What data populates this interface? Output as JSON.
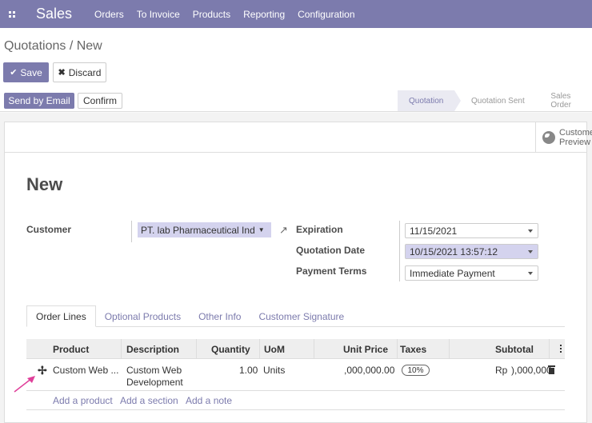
{
  "navbar": {
    "app_name": "Sales",
    "menu": [
      "Orders",
      "To Invoice",
      "Products",
      "Reporting",
      "Configuration"
    ]
  },
  "breadcrumb": "Quotations / New",
  "buttons": {
    "save": "Save",
    "discard": "Discard",
    "send_by_email": "Send by Email",
    "confirm": "Confirm"
  },
  "statusbar": {
    "stages": [
      "Quotation",
      "Quotation Sent",
      "Sales Order"
    ],
    "active": "Quotation"
  },
  "customer_preview": [
    "Customer",
    "Preview"
  ],
  "form": {
    "title": "New",
    "customer_label": "Customer",
    "customer_value": "PT.      lab Pharmaceutical Ind",
    "expiration_label": "Expiration",
    "expiration_value": "11/15/2021",
    "quotation_date_label": "Quotation Date",
    "quotation_date_value": "10/15/2021 13:57:12",
    "payment_terms_label": "Payment Terms",
    "payment_terms_value": "Immediate Payment"
  },
  "tabs": [
    "Order Lines",
    "Optional Products",
    "Other Info",
    "Customer Signature"
  ],
  "order_lines": {
    "headers": [
      "Product",
      "Description",
      "Quantity",
      "UoM",
      "Unit Price",
      "Taxes",
      "Subtotal"
    ],
    "rows": [
      {
        "product": "Custom Web ...",
        "description_1": "Custom Web",
        "description_2": "Development",
        "quantity": "1.00",
        "uom": "Units",
        "unit_price": ",000,000.00",
        "taxes": "10%",
        "subtotal_currency": "Rp",
        "subtotal": "),000,000"
      }
    ],
    "actions": [
      "Add a product",
      "Add a section",
      "Add a note"
    ]
  },
  "colors": {
    "brand": "#7c7bad",
    "highlight": "#d4d3ee"
  }
}
